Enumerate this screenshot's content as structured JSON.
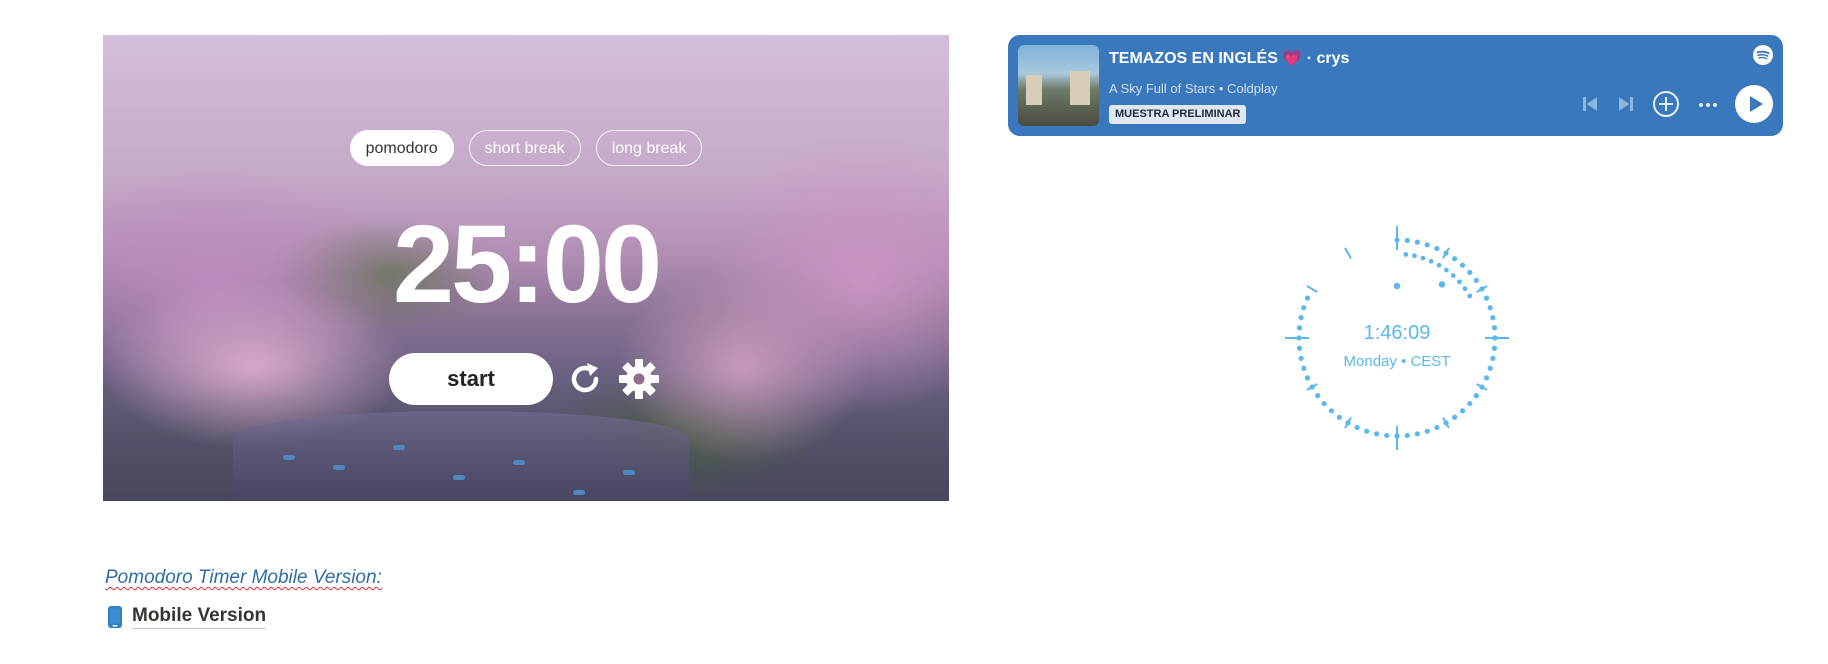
{
  "pomodoro": {
    "modes": [
      {
        "label": "pomodoro",
        "active": true
      },
      {
        "label": "short break",
        "active": false
      },
      {
        "label": "long break",
        "active": false
      }
    ],
    "time": "25:00",
    "start_label": "start",
    "icons": {
      "reset": "reset-icon",
      "settings": "gear-icon"
    }
  },
  "spotify": {
    "playlist_title": "TEMAZOS EN INGLÉS",
    "heart": "💗",
    "separator": "·",
    "owner": "crys",
    "track": "A Sky Full of Stars",
    "dot": "•",
    "artist": "Coldplay",
    "badge": "MUESTRA PRELIMINAR",
    "accent": "#3a78bd",
    "icons": [
      "spotify-logo-icon",
      "previous-icon",
      "next-icon",
      "add-icon",
      "more-icon",
      "play-icon"
    ]
  },
  "clock": {
    "time": "1:46:09",
    "day_tz": "Monday • CEST",
    "color": "#5bb8ee"
  },
  "notes": {
    "heading": "Pomodoro Timer Mobile Version:",
    "link_label": "Mobile Version",
    "link_icon": "mobile-phone-icon"
  }
}
